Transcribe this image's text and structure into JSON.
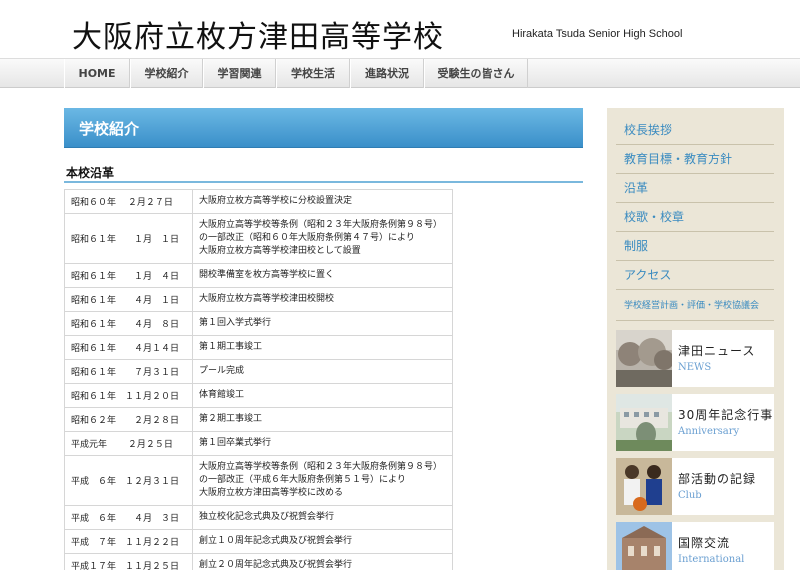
{
  "header": {
    "title": "大阪府立枚方津田高等学校",
    "subtitle": "Hirakata Tsuda Senior High School"
  },
  "nav": {
    "items": [
      {
        "label": "HOME"
      },
      {
        "label": "学校紹介"
      },
      {
        "label": "学習関連"
      },
      {
        "label": "学校生活"
      },
      {
        "label": "進路状況"
      },
      {
        "label": "受験生の皆さん"
      }
    ]
  },
  "main": {
    "heading": "学校紹介",
    "section_title": "本校沿革",
    "history": [
      {
        "date": "昭和６０年　 ２月２７日",
        "event": "大阪府立枚方高等学校に分校設置決定"
      },
      {
        "date": "昭和６１年　　１月　１日",
        "event": "大阪府立高等学校等条例（昭和２３年大阪府条例第９８号）\nの一部改正（昭和６０年大阪府条例第４７号）により\n大阪府立枚方高等学校津田校として設置"
      },
      {
        "date": "昭和６１年　　１月　４日",
        "event": "開校準備室を枚方高等学校に置く"
      },
      {
        "date": "昭和６１年　　４月　１日",
        "event": "大阪府立枚方高等学校津田校開校"
      },
      {
        "date": "昭和６１年　　４月　８日",
        "event": "第１回入学式挙行"
      },
      {
        "date": "昭和６１年　　４月１４日",
        "event": "第１期工事竣工"
      },
      {
        "date": "昭和６１年　　７月３１日",
        "event": "プール完成"
      },
      {
        "date": "昭和６１年　１１月２０日",
        "event": "体育館竣工"
      },
      {
        "date": "昭和６２年　　２月２８日",
        "event": "第２期工事竣工"
      },
      {
        "date": "平成元年　　 ２月２５日",
        "event": "第１回卒業式挙行"
      },
      {
        "date": "平成　６年　１２月３１日",
        "event": "大阪府立高等学校等条例（昭和２３年大阪府条例第９８号）\nの一部改正（平成６年大阪府条例第５１号）により\n大阪府立枚方津田高等学校に改める"
      },
      {
        "date": "平成　６年　　４月　３日",
        "event": "独立校化記念式典及び祝賀会挙行"
      },
      {
        "date": "平成　７年　１１月２２日",
        "event": "創立１０周年記念式典及び祝賀会挙行"
      },
      {
        "date": "平成１７年　１１月２５日",
        "event": "創立２０周年記念式典及び祝賀会挙行"
      }
    ]
  },
  "sidebar": {
    "links": [
      {
        "label": "校長挨拶"
      },
      {
        "label": "教育目標・教育方針"
      },
      {
        "label": "沿革"
      },
      {
        "label": "校歌・校章"
      },
      {
        "label": "制服"
      },
      {
        "label": "アクセス"
      },
      {
        "label": "学校経営計画・評価・学校協議会"
      }
    ],
    "banners": [
      {
        "title": "津田ニュース",
        "sub": "NEWS",
        "icon": "news-photo"
      },
      {
        "title": "30周年記念行事",
        "sub": "Anniversary",
        "icon": "anniversary-photo"
      },
      {
        "title": "部活動の記録",
        "sub": "Club",
        "icon": "club-photo"
      },
      {
        "title": "国際交流",
        "sub": "International",
        "icon": "international-photo"
      }
    ]
  }
}
